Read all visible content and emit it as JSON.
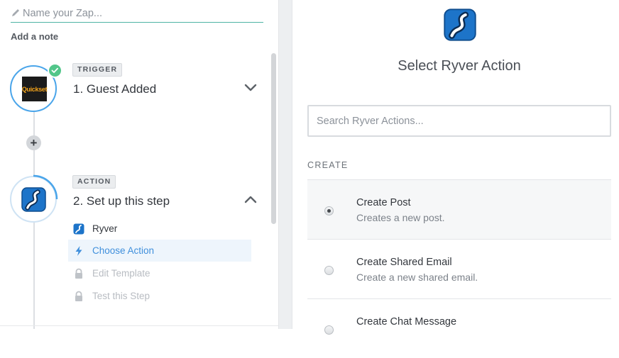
{
  "editor": {
    "zap_name_placeholder": "Name your Zap...",
    "add_note_label": "Add a note"
  },
  "steps": [
    {
      "tag": "TRIGGER",
      "title": "1. Guest Added",
      "app_logo_text": "Quickset",
      "status": "complete",
      "expanded": false
    },
    {
      "tag": "ACTION",
      "title": "2. Set up this step",
      "expanded": true,
      "sub_items": [
        {
          "label": "Ryver",
          "icon": "ryver-app-icon",
          "state": "done"
        },
        {
          "label": "Choose Action",
          "icon": "lightning-bolt-icon",
          "state": "active"
        },
        {
          "label": "Edit Template",
          "icon": "lock-icon",
          "state": "locked"
        },
        {
          "label": "Test this Step",
          "icon": "lock-icon",
          "state": "locked"
        }
      ]
    }
  ],
  "add_step_symbol": "+",
  "action_panel": {
    "title": "Select Ryver Action",
    "search_placeholder": "Search Ryver Actions...",
    "section_label": "CREATE",
    "options": [
      {
        "title": "Create Post",
        "description": "Creates a new post.",
        "selected": true
      },
      {
        "title": "Create Shared Email",
        "description": "Create a new shared email.",
        "selected": false
      },
      {
        "title": "Create Chat Message",
        "description": "",
        "selected": false
      }
    ]
  },
  "colors": {
    "accent_blue": "#4aa5ea",
    "success_green": "#52c68a",
    "active_link": "#3f8fdc",
    "input_underline": "#4fb3a5"
  }
}
